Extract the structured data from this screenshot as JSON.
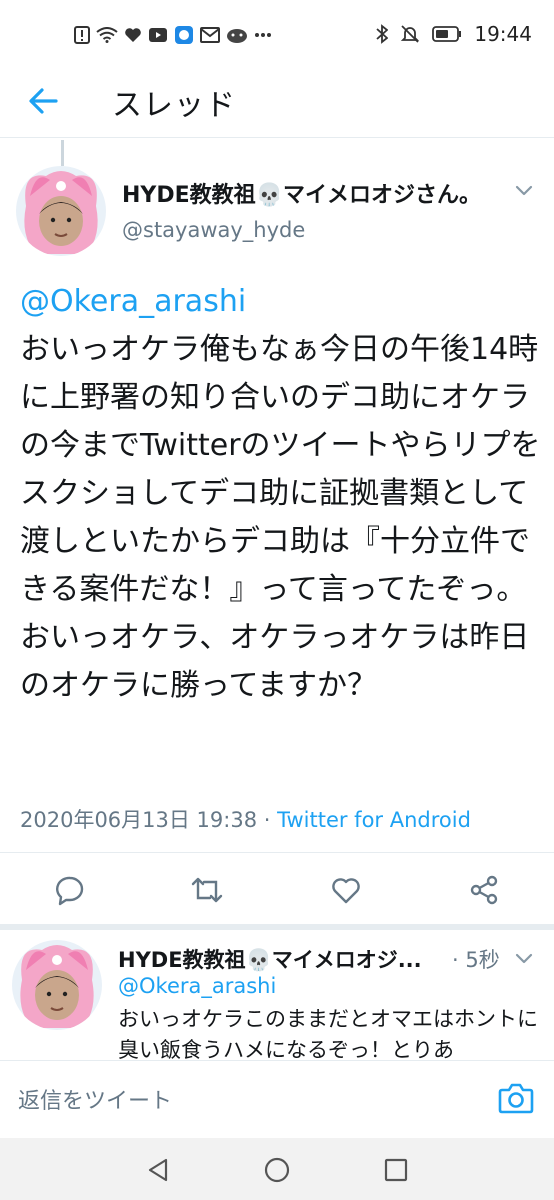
{
  "status_bar": {
    "time": "19:44",
    "left_icons": [
      "alert-icon",
      "wifi-icon",
      "heart-icon",
      "youtube-icon",
      "app-icon",
      "mail-icon",
      "app-icon",
      "more-icon"
    ],
    "right_icons": [
      "bluetooth-icon",
      "mute-icon",
      "battery-icon"
    ]
  },
  "header": {
    "title": "スレッド"
  },
  "tweet": {
    "display_name": "HYDE教教祖💀マイメロオジさん。",
    "handle": "@stayaway_hyde",
    "mention": "@Okera_arashi",
    "text": "おいっオケラ俺もなぁ今日の午後14時に上野署の知り合いのデコ助にオケラの今までTwitterのツイートやらリプをスクショしてデコ助に証拠書類として渡しといたからデコ助は『十分立件できる案件だな！』って言ってたぞっ。おいっオケラ、オケラっオケラは昨日のオケラに勝ってますか？",
    "timestamp": "2020年06月13日 19:38",
    "separator": " · ",
    "client": "Twitter for Android"
  },
  "actions": [
    "reply-icon",
    "retweet-icon",
    "like-icon",
    "share-icon"
  ],
  "reply": {
    "display_name": "HYDE教教祖💀マイメロオジ...",
    "time": "· 5秒",
    "mention": "@Okera_arashi",
    "text": "おいっオケラこのままだとオマエはホントに臭い飯食うハメになるぞっ！とりあ"
  },
  "compose": {
    "placeholder": "返信をツイート"
  },
  "colors": {
    "accent": "#1da1f2",
    "muted": "#657786",
    "text": "#14171a"
  }
}
